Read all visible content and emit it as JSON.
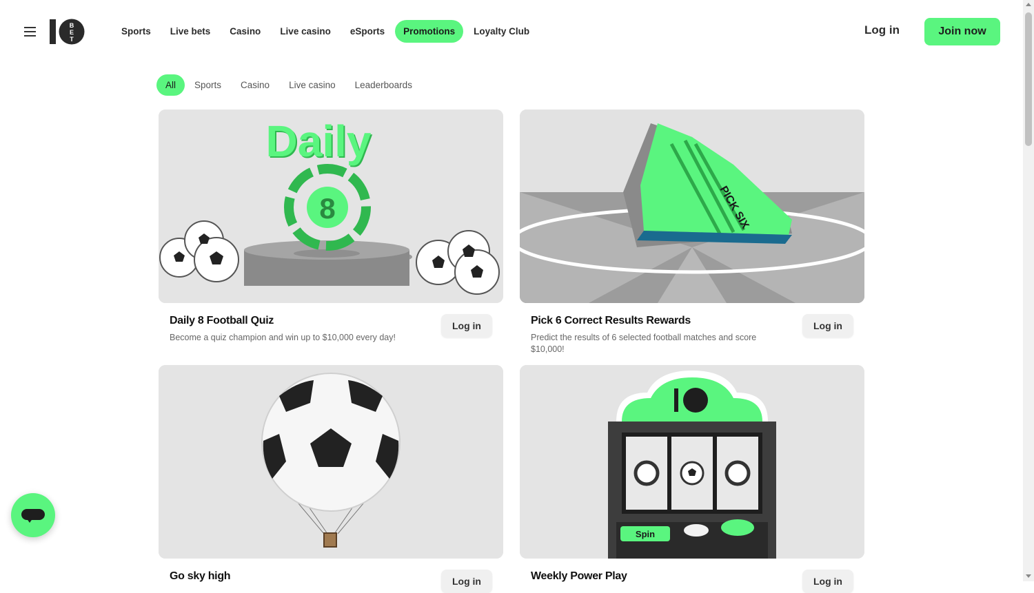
{
  "header": {
    "logo_text": "10BET",
    "nav": [
      {
        "label": "Sports",
        "active": false
      },
      {
        "label": "Live bets",
        "active": false
      },
      {
        "label": "Casino",
        "active": false
      },
      {
        "label": "Live casino",
        "active": false
      },
      {
        "label": "eSports",
        "active": false
      },
      {
        "label": "Promotions",
        "active": true
      },
      {
        "label": "Loyalty Club",
        "active": false
      }
    ],
    "login_label": "Log in",
    "join_label": "Join now"
  },
  "filters": [
    {
      "label": "All",
      "active": true
    },
    {
      "label": "Sports",
      "active": false
    },
    {
      "label": "Casino",
      "active": false
    },
    {
      "label": "Live casino",
      "active": false
    },
    {
      "label": "Leaderboards",
      "active": false
    }
  ],
  "promotions": [
    {
      "title": "Daily 8 Football Quiz",
      "description": "Become a quiz champion and win up to $10,000 every day!",
      "button": "Log in",
      "image_text": "Daily"
    },
    {
      "title": "Pick 6 Correct Results Rewards",
      "description": "Predict the results of 6 selected football matches and score $10,000!",
      "button": "Log in",
      "image_text": "PICK SIX"
    },
    {
      "title": "Go sky high",
      "description": "",
      "button": "Log in",
      "image_text": ""
    },
    {
      "title": "Weekly Power Play",
      "description": "",
      "button": "Log in",
      "image_text": "Spin"
    }
  ],
  "colors": {
    "accent": "#5af57f",
    "card_bg": "#e3e3e3",
    "text_dark": "#111111",
    "text_muted": "#666666"
  },
  "icons": {
    "menu": "hamburger-icon",
    "chat": "chat-icon"
  }
}
